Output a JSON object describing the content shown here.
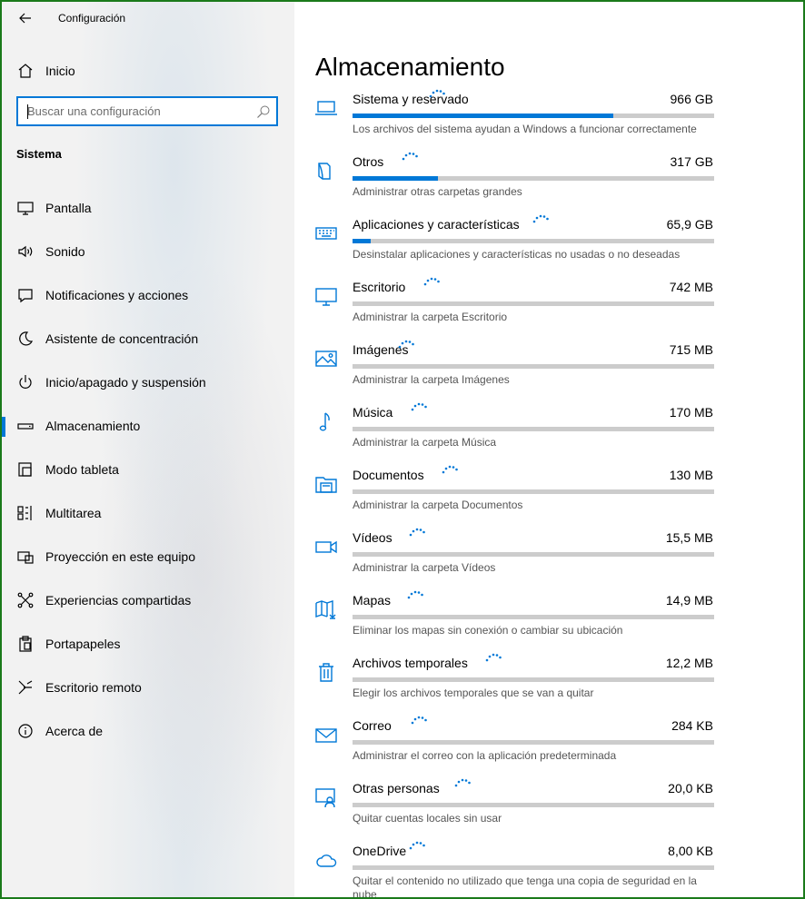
{
  "app": {
    "title": "Configuración",
    "home_label": "Inicio",
    "search_placeholder": "Buscar una configuración",
    "section": "Sistema"
  },
  "colors": {
    "accent": "#0078d7",
    "frame": "#1a7a1a",
    "bar_track": "#cccccc"
  },
  "nav": [
    {
      "label": "Pantalla",
      "icon": "monitor-icon"
    },
    {
      "label": "Sonido",
      "icon": "speaker-icon"
    },
    {
      "label": "Notificaciones y acciones",
      "icon": "notification-icon"
    },
    {
      "label": "Asistente de concentración",
      "icon": "moon-icon"
    },
    {
      "label": "Inicio/apagado y suspensión",
      "icon": "power-icon"
    },
    {
      "label": "Almacenamiento",
      "icon": "storage-drive-icon",
      "selected": true
    },
    {
      "label": "Modo tableta",
      "icon": "tablet-icon"
    },
    {
      "label": "Multitarea",
      "icon": "multitask-icon"
    },
    {
      "label": "Proyección en este equipo",
      "icon": "projection-icon"
    },
    {
      "label": "Experiencias compartidas",
      "icon": "shared-experiences-icon"
    },
    {
      "label": "Portapapeles",
      "icon": "clipboard-icon"
    },
    {
      "label": "Escritorio remoto",
      "icon": "remote-desktop-icon"
    },
    {
      "label": "Acerca de",
      "icon": "info-icon"
    }
  ],
  "main": {
    "title": "Almacenamiento",
    "items": [
      {
        "name": "Sistema y reservado",
        "size": "966 GB",
        "desc": "Los archivos del sistema ayudan a Windows a funcionar correctamente",
        "usage": 0.72,
        "icon": "laptop-icon"
      },
      {
        "name": "Otros",
        "size": "317 GB",
        "desc": "Administrar otras carpetas grandes",
        "usage": 0.235,
        "icon": "other-files-icon"
      },
      {
        "name": "Aplicaciones y características",
        "size": "65,9 GB",
        "desc": "Desinstalar aplicaciones y características no usadas o no deseadas",
        "usage": 0.05,
        "icon": "keyboard-icon"
      },
      {
        "name": "Escritorio",
        "size": "742 MB",
        "desc": "Administrar la carpeta Escritorio",
        "usage": 0,
        "icon": "desktop-icon"
      },
      {
        "name": "Imágenes",
        "size": "715 MB",
        "desc": "Administrar la carpeta Imágenes",
        "usage": 0,
        "icon": "pictures-icon"
      },
      {
        "name": "Música",
        "size": "170 MB",
        "desc": "Administrar la carpeta Música",
        "usage": 0,
        "icon": "music-note-icon"
      },
      {
        "name": "Documentos",
        "size": "130 MB",
        "desc": "Administrar la carpeta Documentos",
        "usage": 0,
        "icon": "documents-folder-icon"
      },
      {
        "name": "Vídeos",
        "size": "15,5 MB",
        "desc": "Administrar la carpeta Vídeos",
        "usage": 0,
        "icon": "video-camera-icon"
      },
      {
        "name": "Mapas",
        "size": "14,9 MB",
        "desc": "Eliminar los mapas sin conexión o cambiar su ubicación",
        "usage": 0,
        "icon": "map-icon"
      },
      {
        "name": "Archivos temporales",
        "size": "12,2 MB",
        "desc": "Elegir los archivos temporales que se van a quitar",
        "usage": 0,
        "icon": "trash-icon"
      },
      {
        "name": "Correo",
        "size": "284 KB",
        "desc": "Administrar el correo con la aplicación predeterminada",
        "usage": 0,
        "icon": "mail-icon"
      },
      {
        "name": "Otras personas",
        "size": "20,0 KB",
        "desc": "Quitar cuentas locales sin usar",
        "usage": 0,
        "icon": "other-people-icon"
      },
      {
        "name": "OneDrive",
        "size": "8,00 KB",
        "desc": "Quitar el contenido no utilizado que tenga una copia de seguridad en la nube",
        "usage": 0,
        "icon": "cloud-icon"
      }
    ]
  }
}
